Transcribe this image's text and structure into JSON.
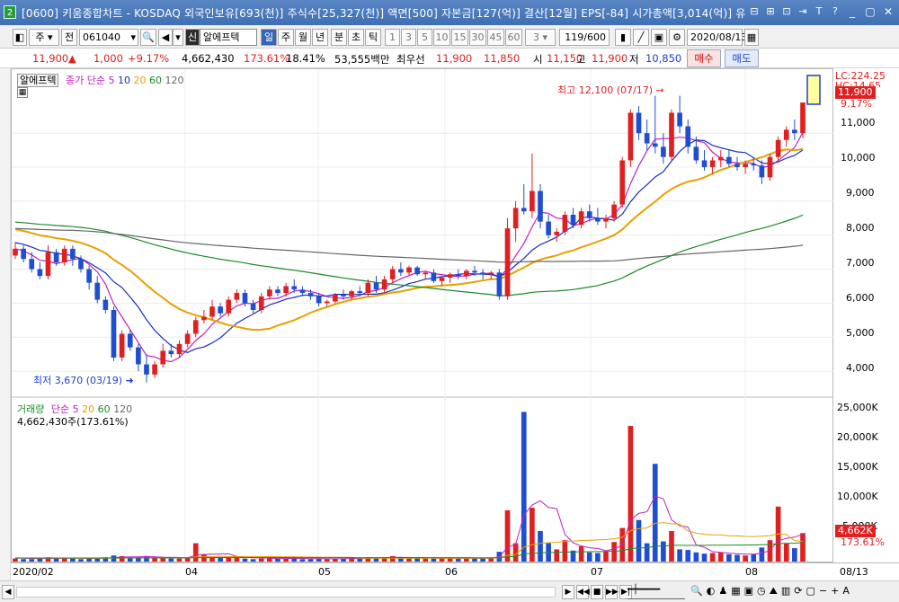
{
  "title": {
    "num": "2",
    "text": "[0600] 키움종합차트 - KOSDAQ 외국인보유[693(천)] 주식수[25,327(천)] 액면[500] 자본금[127(억)] 결산[12월] EPS[-84] 시가총액[3,014(억)] 유",
    "icons": [
      "⊟",
      "⊞",
      "⊡",
      "⇥",
      "T",
      "?"
    ],
    "window_buttons": [
      "_",
      "▢",
      "✕"
    ]
  },
  "toolbar": {
    "period_label": "주",
    "prev_label": "전",
    "code": "061040",
    "sin_label": "신",
    "stock_name": "알에프텍",
    "day": "일",
    "week": "주",
    "month": "월",
    "year": "년",
    "minute": "분",
    "second": "초",
    "tick": "틱",
    "nums": [
      "1",
      "3",
      "5",
      "10",
      "15",
      "30",
      "45",
      "60"
    ],
    "interval": "3",
    "count": "119/600",
    "date": "2020/08/13"
  },
  "quote": {
    "price": "11,900",
    "change": "1,000",
    "change_pct": "+9.17%",
    "volume": "4,662,430",
    "vol_ratio": "173.61%",
    "turnover": "18.41%",
    "amount": "53,555백만",
    "best_label": "최우선",
    "ask": "11,900",
    "bid": "11,850",
    "open_label": "시",
    "open": "11,150",
    "high_label": "고",
    "high": "11,900",
    "low_label": "저",
    "low": "10,850",
    "buy_label": "매수",
    "sell_label": "매도"
  },
  "price_panel": {
    "name": "알에프텍",
    "ma_label": "종가 단순",
    "ma_periods": [
      "5",
      "10",
      "20",
      "60",
      "120"
    ],
    "ma_colors": [
      "#c020c0",
      "#1a2fbf",
      "#e8a000",
      "#1a8a2a",
      "#666666"
    ],
    "hi_annot": "최고 12,100 (07/17)",
    "lo_annot": "최저 3,670 (03/19)",
    "lc_label": "LC:224.25",
    "hc_label": "HC:14.65",
    "last_price_box": "11,900",
    "last_pct": "9.17%",
    "y_ticks": [
      "11,000",
      "10,000",
      "9,000",
      "8,000",
      "7,000",
      "6,000",
      "5,000",
      "4,000"
    ]
  },
  "volume_panel": {
    "label": "거래량",
    "ma_label": "단순",
    "ma_periods": [
      "5",
      "20",
      "60",
      "120"
    ],
    "value_text": "4,662,430주(173.61%)",
    "y_ticks": [
      "25,000K",
      "20,000K",
      "15,000K",
      "10,000K",
      "5,000K"
    ],
    "last_vol_box": "4,662K",
    "last_pct": "173.61%"
  },
  "dates": [
    "2020/02",
    "04",
    "05",
    "06",
    "07",
    "08",
    "08/13"
  ],
  "colors": {
    "up": "#e02020",
    "down": "#1f4fd0",
    "accent": "#3466b8"
  },
  "chart_data": {
    "type": "candlestick",
    "x_range": [
      "2020/02",
      "2020/08/13"
    ],
    "price_ylim": [
      3500,
      12300
    ],
    "volume_ylim": [
      0,
      25000000
    ],
    "candles": [
      [
        7400,
        7800,
        7300,
        7600
      ],
      [
        7600,
        7700,
        7200,
        7300
      ],
      [
        7300,
        7500,
        6900,
        7000
      ],
      [
        7000,
        7200,
        6700,
        6800
      ],
      [
        6800,
        7700,
        6700,
        7500
      ],
      [
        7500,
        7600,
        7100,
        7200
      ],
      [
        7200,
        7700,
        7100,
        7600
      ],
      [
        7600,
        7700,
        7100,
        7300
      ],
      [
        7300,
        7400,
        6900,
        7000
      ],
      [
        7000,
        7100,
        6400,
        6600
      ],
      [
        6600,
        6800,
        6000,
        6100
      ],
      [
        6100,
        6200,
        5700,
        5800
      ],
      [
        5800,
        5900,
        4300,
        4400
      ],
      [
        4400,
        5200,
        4300,
        5100
      ],
      [
        5100,
        5200,
        4600,
        4700
      ],
      [
        4700,
        4800,
        4000,
        4200
      ],
      [
        4200,
        4500,
        3670,
        3900
      ],
      [
        3900,
        4300,
        3800,
        4200
      ],
      [
        4200,
        4800,
        4100,
        4600
      ],
      [
        4600,
        4800,
        4400,
        4500
      ],
      [
        4500,
        4900,
        4400,
        4800
      ],
      [
        4800,
        5200,
        4700,
        5100
      ],
      [
        5100,
        5600,
        5000,
        5500
      ],
      [
        5500,
        5800,
        5400,
        5600
      ],
      [
        5600,
        6100,
        5500,
        5900
      ],
      [
        5900,
        6000,
        5600,
        5700
      ],
      [
        5700,
        6200,
        5600,
        6100
      ],
      [
        6100,
        6400,
        6000,
        6300
      ],
      [
        6300,
        6400,
        5900,
        6000
      ],
      [
        6000,
        6100,
        5700,
        5800
      ],
      [
        5800,
        6300,
        5700,
        6200
      ],
      [
        6200,
        6500,
        6100,
        6400
      ],
      [
        6400,
        6500,
        6200,
        6300
      ],
      [
        6300,
        6600,
        6200,
        6500
      ],
      [
        6500,
        6700,
        6300,
        6400
      ],
      [
        6400,
        6500,
        6200,
        6300
      ],
      [
        6300,
        6400,
        6100,
        6200
      ],
      [
        6200,
        6300,
        5900,
        6000
      ],
      [
        6000,
        6100,
        5900,
        6050
      ],
      [
        6050,
        6300,
        6000,
        6250
      ],
      [
        6250,
        6400,
        6100,
        6200
      ],
      [
        6200,
        6400,
        6100,
        6350
      ],
      [
        6350,
        6500,
        6200,
        6300
      ],
      [
        6300,
        6700,
        6200,
        6600
      ],
      [
        6600,
        6800,
        6300,
        6400
      ],
      [
        6400,
        6800,
        6300,
        6700
      ],
      [
        6700,
        7100,
        6600,
        7000
      ],
      [
        7000,
        7200,
        6800,
        6900
      ],
      [
        6900,
        7100,
        6800,
        7050
      ],
      [
        7050,
        7100,
        6800,
        6850
      ],
      [
        6850,
        6950,
        6700,
        6900
      ],
      [
        6900,
        7000,
        6600,
        6650
      ],
      [
        6650,
        6800,
        6500,
        6750
      ],
      [
        6750,
        6900,
        6600,
        6850
      ],
      [
        6850,
        7000,
        6700,
        6800
      ],
      [
        6800,
        7000,
        6700,
        6950
      ],
      [
        6950,
        7100,
        6800,
        6900
      ],
      [
        6900,
        7000,
        6700,
        6850
      ],
      [
        6850,
        6950,
        6700,
        6900
      ],
      [
        6900,
        7000,
        6100,
        6200
      ],
      [
        6200,
        8500,
        6100,
        8200
      ],
      [
        8200,
        9000,
        7800,
        8800
      ],
      [
        8800,
        9500,
        8600,
        8700
      ],
      [
        8700,
        10400,
        8500,
        9300
      ],
      [
        9300,
        9500,
        8200,
        8400
      ],
      [
        8400,
        8600,
        7900,
        8000
      ],
      [
        8000,
        8200,
        7800,
        8100
      ],
      [
        8100,
        8700,
        8000,
        8600
      ],
      [
        8600,
        8800,
        8200,
        8300
      ],
      [
        8300,
        8800,
        8200,
        8700
      ],
      [
        8700,
        8900,
        8400,
        8500
      ],
      [
        8500,
        8800,
        8300,
        8400
      ],
      [
        8400,
        8600,
        8200,
        8500
      ],
      [
        8500,
        9000,
        8400,
        8900
      ],
      [
        8900,
        10300,
        8800,
        10200
      ],
      [
        10200,
        11700,
        10000,
        11600
      ],
      [
        11600,
        11800,
        10800,
        11000
      ],
      [
        11000,
        11400,
        10500,
        10700
      ],
      [
        10700,
        12100,
        10400,
        10600
      ],
      [
        10600,
        11000,
        10100,
        10300
      ],
      [
        10300,
        11700,
        10200,
        11600
      ],
      [
        11600,
        12100,
        11000,
        11200
      ],
      [
        11200,
        11400,
        10400,
        10600
      ],
      [
        10600,
        10900,
        10100,
        10200
      ],
      [
        10200,
        10500,
        9900,
        10000
      ],
      [
        10000,
        10300,
        9800,
        10200
      ],
      [
        10200,
        10500,
        10000,
        10300
      ],
      [
        10300,
        10500,
        10000,
        10100
      ],
      [
        10100,
        10300,
        9900,
        10000
      ],
      [
        10000,
        10200,
        9800,
        10100
      ],
      [
        10100,
        10300,
        9900,
        10050
      ],
      [
        10050,
        10200,
        9500,
        9700
      ],
      [
        9700,
        10400,
        9600,
        10300
      ],
      [
        10300,
        10900,
        10200,
        10800
      ],
      [
        10800,
        11200,
        10600,
        11100
      ],
      [
        11100,
        11400,
        10800,
        11000
      ],
      [
        11000,
        11900,
        10850,
        11900
      ]
    ],
    "volumes": [
      0.5,
      0.4,
      0.4,
      0.6,
      0.7,
      0.5,
      0.6,
      0.5,
      0.4,
      0.5,
      0.6,
      0.7,
      1.0,
      0.9,
      0.6,
      0.7,
      0.9,
      0.8,
      0.6,
      0.5,
      0.5,
      0.6,
      3.0,
      1.2,
      0.8,
      0.6,
      0.7,
      0.9,
      0.5,
      0.4,
      0.5,
      0.6,
      0.5,
      0.5,
      0.6,
      0.4,
      0.4,
      0.5,
      0.4,
      0.5,
      0.5,
      0.6,
      0.5,
      0.7,
      0.6,
      0.7,
      0.9,
      0.6,
      0.5,
      0.6,
      0.5,
      0.5,
      0.6,
      0.6,
      0.5,
      0.6,
      0.5,
      0.5,
      0.6,
      1.6,
      8.4,
      3.0,
      24.5,
      8.8,
      5.0,
      3.0,
      2.0,
      3.5,
      1.8,
      2.5,
      1.5,
      1.4,
      1.7,
      3.2,
      5.5,
      22.2,
      6.8,
      3.0,
      16.0,
      3.3,
      5.0,
      2.0,
      1.9,
      1.5,
      1.3,
      1.4,
      1.5,
      1.2,
      1.1,
      1.0,
      1.2,
      2.3,
      3.5,
      9.0,
      3.0,
      2.2,
      4.66
    ],
    "max_price": "12,100",
    "min_price": "3,670"
  }
}
